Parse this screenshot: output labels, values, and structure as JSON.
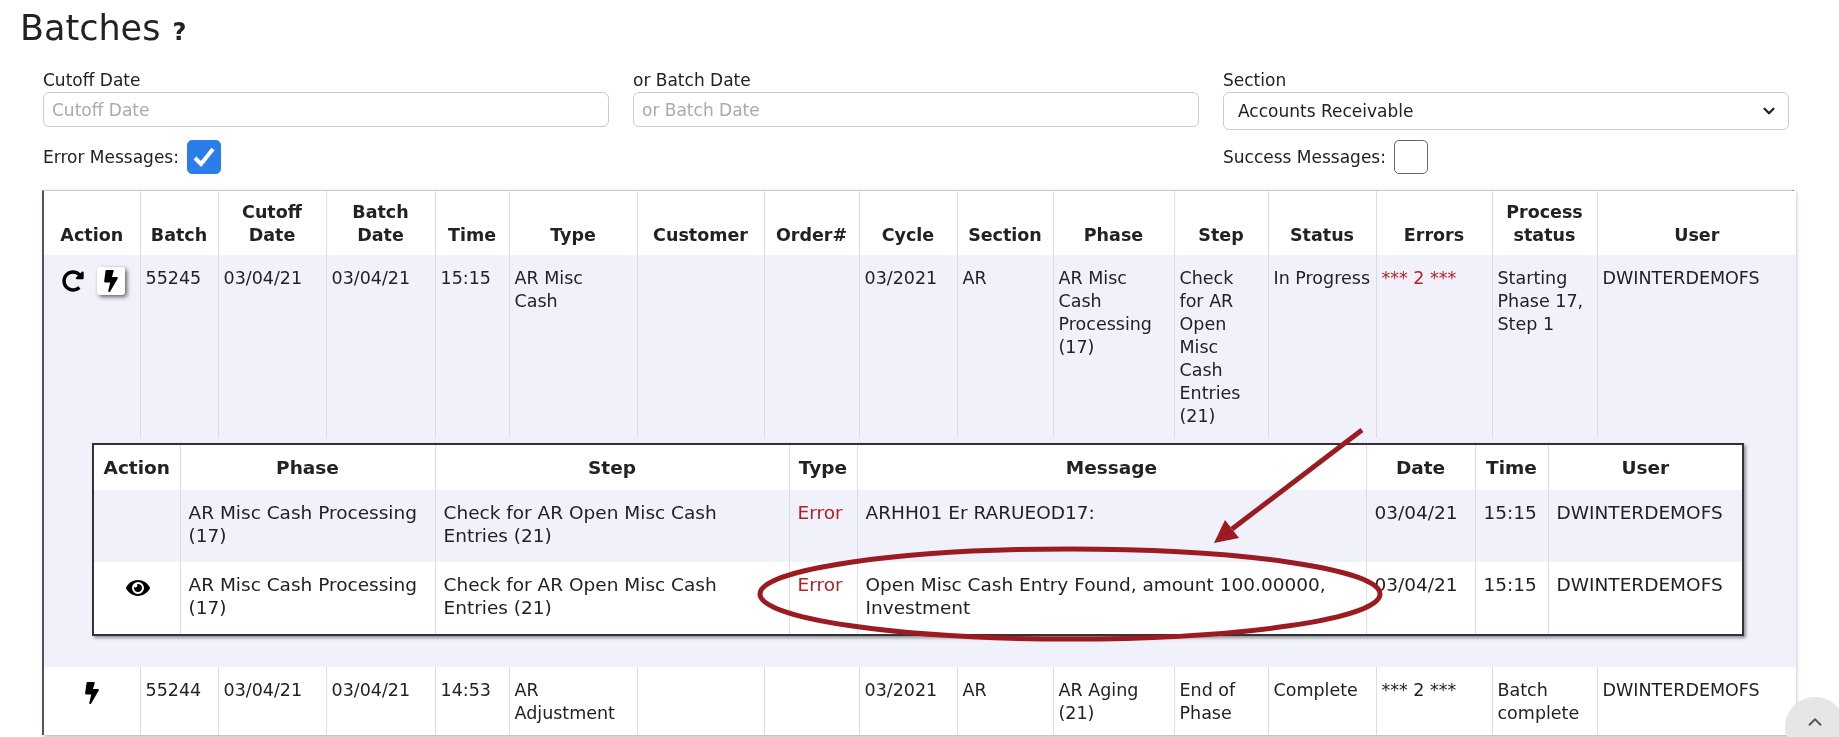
{
  "page": {
    "title": "Batches",
    "help": "?"
  },
  "filters": {
    "cutoff_date": {
      "label": "Cutoff Date",
      "placeholder": "Cutoff Date"
    },
    "batch_date": {
      "label": "or Batch Date",
      "placeholder": "or Batch Date"
    },
    "section": {
      "label": "Section",
      "value": "Accounts Receivable"
    },
    "error_messages": {
      "label": "Error Messages:",
      "checked": true
    },
    "success_messages": {
      "label": "Success Messages:",
      "checked": false
    }
  },
  "table": {
    "columns": [
      "Action",
      "Batch",
      "Cutoff Date",
      "Batch Date",
      "Time",
      "Type",
      "Customer",
      "Order#",
      "Cycle",
      "Section",
      "Phase",
      "Step",
      "Status",
      "Errors",
      "Process status",
      "User"
    ],
    "rows": [
      {
        "selected": true,
        "can_retry": true,
        "can_run": true,
        "run_raised": true,
        "errors_highlighted": true,
        "cells": [
          "",
          "55245",
          "03/04/21",
          "03/04/21",
          "15:15",
          "AR Misc Cash",
          "",
          "",
          "03/2021",
          "AR",
          "AR Misc Cash Processing (17)",
          "Check for AR Open Misc Cash Entries (21)",
          "In Progress",
          "*** 2 ***",
          "Starting Phase 17, Step 1",
          "DWINTERDEMOFS"
        ],
        "details": {
          "columns": [
            "Action",
            "Phase",
            "Step",
            "Type",
            "Message",
            "Date",
            "Time",
            "User"
          ],
          "rows": [
            {
              "selected": true,
              "can_view": false,
              "kind": "error",
              "cells": [
                "",
                "AR Misc Cash Processing (17)",
                "Check for AR Open Misc Cash Entries (21)",
                "Error",
                "ARHH01 Er RARUEOD17:",
                "03/04/21",
                "15:15",
                "DWINTERDEMOFS"
              ]
            },
            {
              "selected": false,
              "can_view": true,
              "kind": "error",
              "cells": [
                "",
                "AR Misc Cash Processing (17)",
                "Check for AR Open Misc Cash Entries (21)",
                "Error",
                "Open Misc Cash Entry Found, amount 100.00000, Investment",
                "03/04/21",
                "15:15",
                "DWINTERDEMOFS"
              ]
            }
          ]
        }
      },
      {
        "selected": false,
        "can_retry": false,
        "can_run": true,
        "run_raised": false,
        "errors_highlighted": false,
        "cells": [
          "",
          "55244",
          "03/04/21",
          "03/04/21",
          "14:53",
          "AR Adjustment",
          "",
          "",
          "03/2021",
          "AR",
          "AR Aging (21)",
          "End of Phase",
          "Complete",
          "*** 2 ***",
          "Batch complete",
          "DWINTERDEMOFS"
        ]
      }
    ]
  }
}
